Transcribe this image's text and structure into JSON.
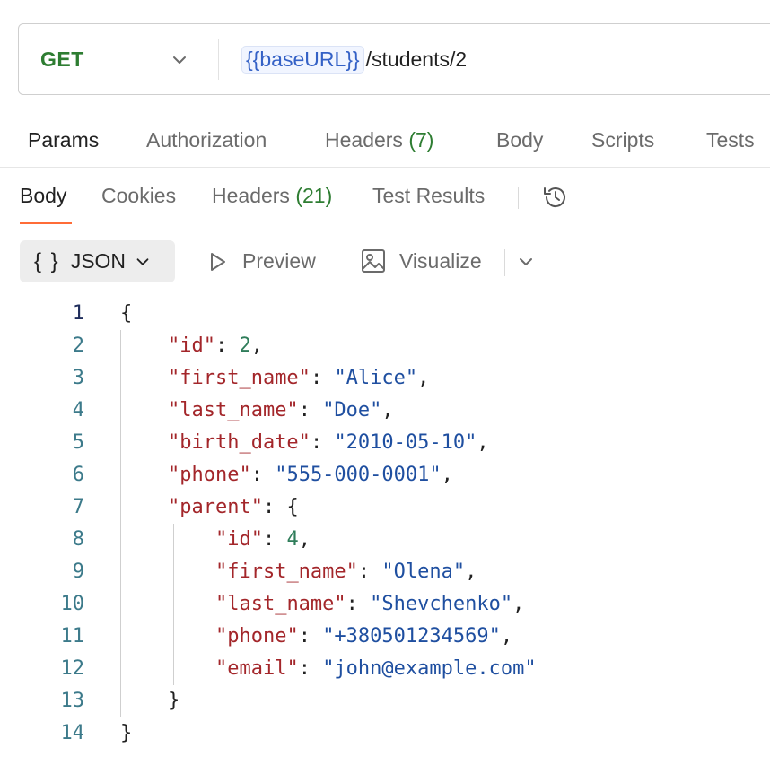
{
  "request": {
    "method": "GET",
    "url_variable": "{{baseURL}}",
    "url_path": "/students/2"
  },
  "request_tabs": [
    {
      "label": "Params",
      "count": null,
      "active": true
    },
    {
      "label": "Authorization",
      "count": null,
      "active": false
    },
    {
      "label": "Headers",
      "count": "(7)",
      "active": false
    },
    {
      "label": "Body",
      "count": null,
      "active": false
    },
    {
      "label": "Scripts",
      "count": null,
      "active": false
    },
    {
      "label": "Tests",
      "count": null,
      "active": false
    }
  ],
  "response_tabs": [
    {
      "label": "Body",
      "count": null,
      "active": true
    },
    {
      "label": "Cookies",
      "count": null,
      "active": false
    },
    {
      "label": "Headers",
      "count": "(21)",
      "active": false
    },
    {
      "label": "Test Results",
      "count": null,
      "active": false
    }
  ],
  "toolbar": {
    "format_braces": "{ }",
    "format_label": "JSON",
    "preview_label": "Preview",
    "visualize_label": "Visualize"
  },
  "icons": {
    "method_dropdown": "chevron-down-icon",
    "history": "history-icon",
    "format_dropdown": "chevron-down-icon",
    "preview": "play-icon",
    "visualize": "image-icon",
    "more": "chevron-down-icon"
  },
  "colors": {
    "method": "#2e7d32",
    "variable": "#3461c6",
    "active_underline": "#ff6c37",
    "json_key": "#a3262a",
    "json_string": "#1f4fa0",
    "json_number": "#2f7d5a"
  },
  "code_lines": [
    {
      "num": "1",
      "tokens": [
        {
          "t": "p",
          "v": "{"
        }
      ]
    },
    {
      "num": "2",
      "tokens": [
        {
          "t": "p",
          "v": "    "
        },
        {
          "t": "k",
          "v": "\"id\""
        },
        {
          "t": "p",
          "v": ": "
        },
        {
          "t": "n",
          "v": "2"
        },
        {
          "t": "p",
          "v": ","
        }
      ]
    },
    {
      "num": "3",
      "tokens": [
        {
          "t": "p",
          "v": "    "
        },
        {
          "t": "k",
          "v": "\"first_name\""
        },
        {
          "t": "p",
          "v": ": "
        },
        {
          "t": "s",
          "v": "\"Alice\""
        },
        {
          "t": "p",
          "v": ","
        }
      ]
    },
    {
      "num": "4",
      "tokens": [
        {
          "t": "p",
          "v": "    "
        },
        {
          "t": "k",
          "v": "\"last_name\""
        },
        {
          "t": "p",
          "v": ": "
        },
        {
          "t": "s",
          "v": "\"Doe\""
        },
        {
          "t": "p",
          "v": ","
        }
      ]
    },
    {
      "num": "5",
      "tokens": [
        {
          "t": "p",
          "v": "    "
        },
        {
          "t": "k",
          "v": "\"birth_date\""
        },
        {
          "t": "p",
          "v": ": "
        },
        {
          "t": "s",
          "v": "\"2010-05-10\""
        },
        {
          "t": "p",
          "v": ","
        }
      ]
    },
    {
      "num": "6",
      "tokens": [
        {
          "t": "p",
          "v": "    "
        },
        {
          "t": "k",
          "v": "\"phone\""
        },
        {
          "t": "p",
          "v": ": "
        },
        {
          "t": "s",
          "v": "\"555-000-0001\""
        },
        {
          "t": "p",
          "v": ","
        }
      ]
    },
    {
      "num": "7",
      "tokens": [
        {
          "t": "p",
          "v": "    "
        },
        {
          "t": "k",
          "v": "\"parent\""
        },
        {
          "t": "p",
          "v": ": {"
        }
      ]
    },
    {
      "num": "8",
      "tokens": [
        {
          "t": "p",
          "v": "        "
        },
        {
          "t": "k",
          "v": "\"id\""
        },
        {
          "t": "p",
          "v": ": "
        },
        {
          "t": "n",
          "v": "4"
        },
        {
          "t": "p",
          "v": ","
        }
      ]
    },
    {
      "num": "9",
      "tokens": [
        {
          "t": "p",
          "v": "        "
        },
        {
          "t": "k",
          "v": "\"first_name\""
        },
        {
          "t": "p",
          "v": ": "
        },
        {
          "t": "s",
          "v": "\"Olena\""
        },
        {
          "t": "p",
          "v": ","
        }
      ]
    },
    {
      "num": "10",
      "tokens": [
        {
          "t": "p",
          "v": "        "
        },
        {
          "t": "k",
          "v": "\"last_name\""
        },
        {
          "t": "p",
          "v": ": "
        },
        {
          "t": "s",
          "v": "\"Shevchenko\""
        },
        {
          "t": "p",
          "v": ","
        }
      ]
    },
    {
      "num": "11",
      "tokens": [
        {
          "t": "p",
          "v": "        "
        },
        {
          "t": "k",
          "v": "\"phone\""
        },
        {
          "t": "p",
          "v": ": "
        },
        {
          "t": "s",
          "v": "\"+380501234569\""
        },
        {
          "t": "p",
          "v": ","
        }
      ]
    },
    {
      "num": "12",
      "tokens": [
        {
          "t": "p",
          "v": "        "
        },
        {
          "t": "k",
          "v": "\"email\""
        },
        {
          "t": "p",
          "v": ": "
        },
        {
          "t": "s",
          "v": "\"john@example.com\""
        }
      ]
    },
    {
      "num": "13",
      "tokens": [
        {
          "t": "p",
          "v": "    }"
        }
      ]
    },
    {
      "num": "14",
      "tokens": [
        {
          "t": "p",
          "v": "}"
        }
      ]
    }
  ]
}
